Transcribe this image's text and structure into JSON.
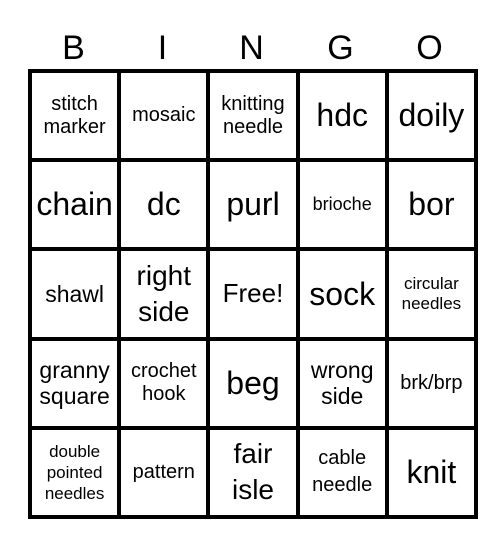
{
  "header": {
    "letters": [
      "B",
      "I",
      "N",
      "G",
      "O"
    ]
  },
  "board": {
    "rows": [
      [
        "stitch\nmarker",
        "mosaic",
        "knitting\nneedle",
        "hdc",
        "doily"
      ],
      [
        "chain",
        "dc",
        "purl",
        "brioche",
        "bor"
      ],
      [
        "shawl",
        "right\nside",
        "Free!",
        "sock",
        "circular\nneedles"
      ],
      [
        "granny\nsquare",
        "crochet\nhook",
        "beg",
        "wrong\nside",
        "brk/brp"
      ],
      [
        "double\npointed\nneedles",
        "pattern",
        "fair\nisle",
        "cable\nneedle",
        "knit"
      ]
    ],
    "free_space": "Free!"
  },
  "colors": {
    "border": "#000000",
    "background": "#ffffff",
    "text": "#000000"
  }
}
